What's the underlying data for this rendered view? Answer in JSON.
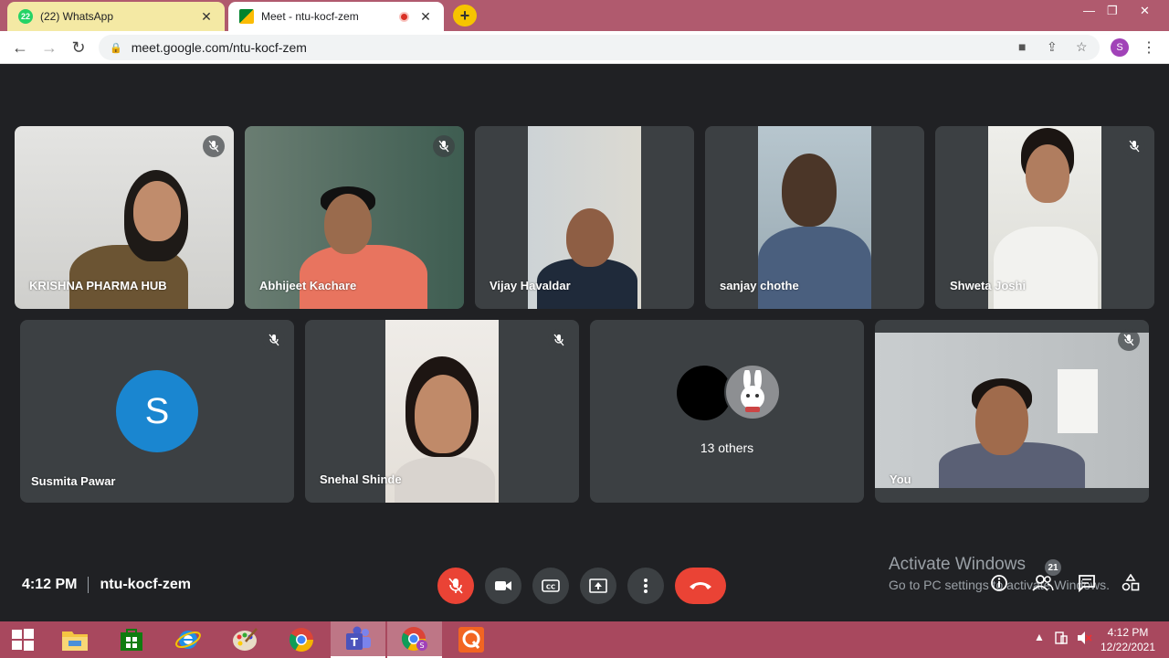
{
  "browser": {
    "tabs": [
      {
        "title": "(22) WhatsApp",
        "badge": "22",
        "active": false
      },
      {
        "title": "Meet - ntu-kocf-zem",
        "active": true
      }
    ],
    "url": "meet.google.com/ntu-kocf-zem",
    "profile_initial": "S"
  },
  "participants": [
    {
      "name": "KRISHNA PHARMA HUB",
      "muted": true
    },
    {
      "name": "Abhijeet Kachare",
      "muted": true
    },
    {
      "name": "Vijay Havaldar",
      "muted": false
    },
    {
      "name": "sanjay chothe",
      "muted": false
    },
    {
      "name": "Shweta Joshi",
      "muted": true
    },
    {
      "name": "Susmita Pawar",
      "initial": "S",
      "muted": true
    },
    {
      "name": "Snehal Shinde",
      "muted": true
    },
    {
      "name": "You",
      "muted": true
    }
  ],
  "others": {
    "label": "13 others"
  },
  "meeting": {
    "time": "4:12 PM",
    "code": "ntu-kocf-zem",
    "people_count": "21"
  },
  "controls": [
    {
      "icon": "mic-off-icon",
      "label": "Microphone"
    },
    {
      "icon": "camera-icon",
      "label": "Camera"
    },
    {
      "icon": "captions-icon",
      "label": "Captions"
    },
    {
      "icon": "present-icon",
      "label": "Present"
    },
    {
      "icon": "more-icon",
      "label": "More options"
    },
    {
      "icon": "hangup-icon",
      "label": "Leave call"
    }
  ],
  "watermark": {
    "line1": "Activate Windows",
    "line2": "Go to PC settings to activate Windows."
  },
  "taskbar": {
    "time": "4:12 PM",
    "date": "12/22/2021"
  },
  "colors": {
    "tab_strip": "#b05a6e",
    "meet_bg": "#202124",
    "tile_bg": "#3c4043",
    "danger": "#ea4335",
    "taskbar": "#a8485e"
  }
}
